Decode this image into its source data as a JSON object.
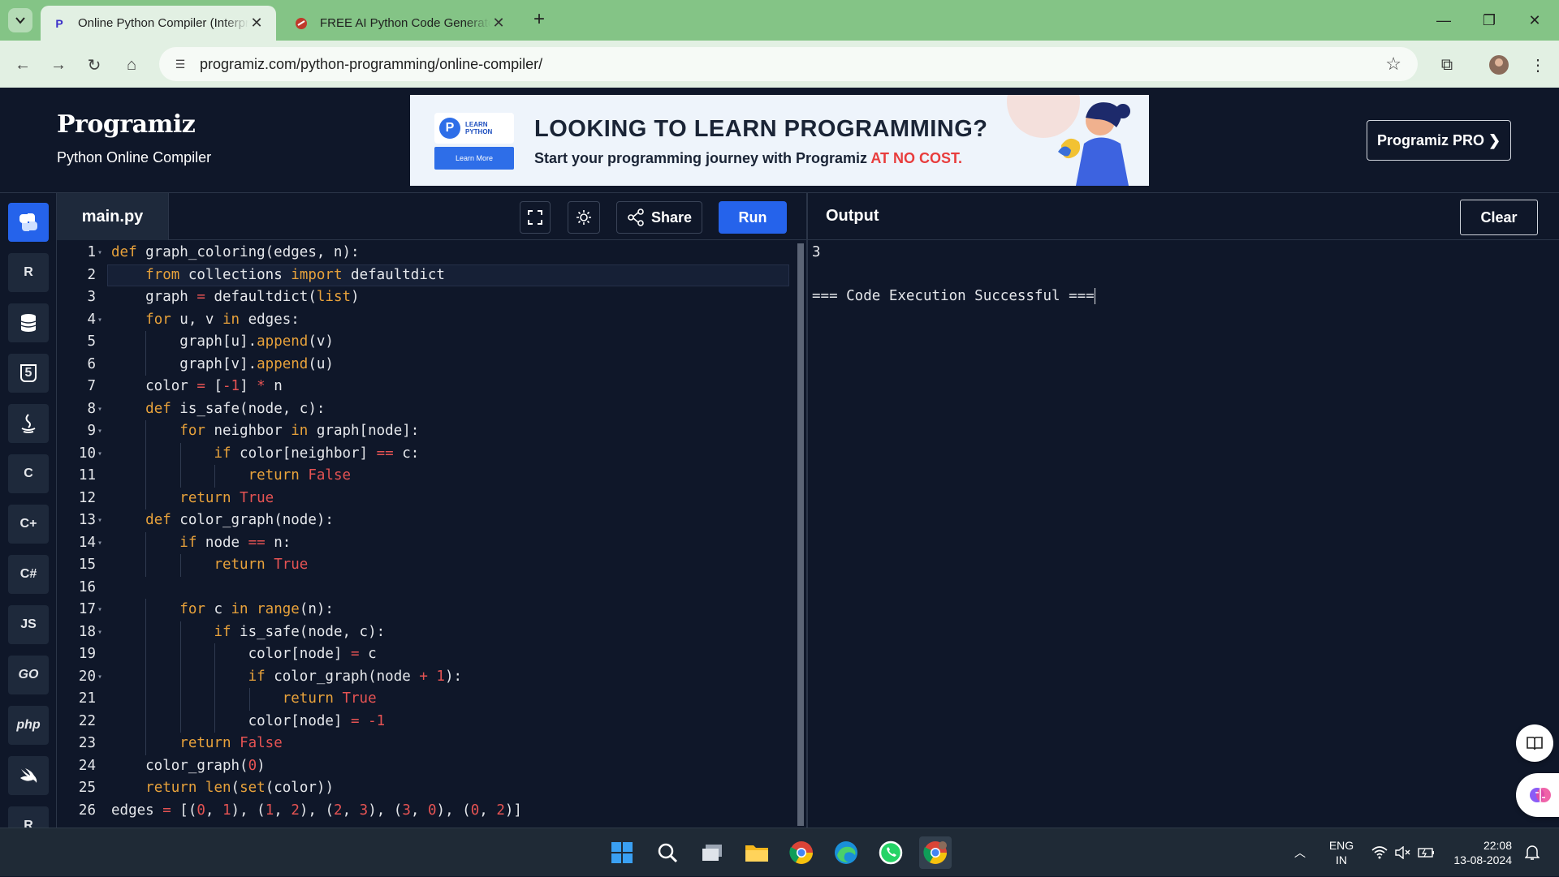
{
  "browser": {
    "tabs": [
      {
        "title": "Online Python Compiler (Interpreter)",
        "active": true
      },
      {
        "title": "FREE AI Python Code Generator",
        "active": false
      }
    ],
    "url": "programiz.com/python-programming/online-compiler/"
  },
  "header": {
    "logo_text": "Programiz",
    "subtitle": "Python Online Compiler",
    "pro_button": "Programiz PRO ❯"
  },
  "ad_banner": {
    "badge_line1": "LEARN",
    "badge_line2": "PYTHON",
    "learn_more": "Learn More",
    "headline": "LOOKING TO LEARN PROGRAMMING?",
    "sub_prefix": "Start your programming journey with Programiz ",
    "sub_highlight": "AT NO COST."
  },
  "sidebar": {
    "languages": [
      {
        "name": "python-icon",
        "label": "",
        "active": true
      },
      {
        "name": "r-icon",
        "label": "R"
      },
      {
        "name": "sql-icon",
        "label": ""
      },
      {
        "name": "html-icon",
        "label": "5"
      },
      {
        "name": "java-icon",
        "label": ""
      },
      {
        "name": "c-icon",
        "label": "C"
      },
      {
        "name": "cpp-icon",
        "label": "C+"
      },
      {
        "name": "csharp-icon",
        "label": "C#"
      },
      {
        "name": "js-icon",
        "label": "JS"
      },
      {
        "name": "go-icon",
        "label": "GO"
      },
      {
        "name": "php-icon",
        "label": "php"
      },
      {
        "name": "swift-icon",
        "label": ""
      },
      {
        "name": "rust-icon",
        "label": "R"
      }
    ]
  },
  "editor": {
    "file_name": "main.py",
    "share_label": "Share",
    "run_label": "Run",
    "lines": [
      "def graph_coloring(edges, n):",
      "    from collections import defaultdict",
      "    graph = defaultdict(list)",
      "    for u, v in edges:",
      "        graph[u].append(v)",
      "        graph[v].append(u)",
      "    color = [-1] * n",
      "    def is_safe(node, c):",
      "        for neighbor in graph[node]:",
      "            if color[neighbor] == c:",
      "                return False",
      "        return True",
      "    def color_graph(node):",
      "        if node == n:",
      "            return True",
      "",
      "        for c in range(n):",
      "            if is_safe(node, c):",
      "                color[node] = c",
      "                if color_graph(node + 1):",
      "                    return True",
      "                color[node] = -1",
      "        return False",
      "    color_graph(0)",
      "    return len(set(color))",
      "edges = [(0, 1), (1, 2), (2, 3), (3, 0), (0, 2)]"
    ],
    "fold_lines": [
      1,
      4,
      8,
      9,
      10,
      13,
      14,
      17,
      18,
      20
    ],
    "highlight_line": 2
  },
  "output": {
    "title": "Output",
    "clear_label": "Clear",
    "lines": [
      "3",
      "",
      "=== Code Execution Successful ==="
    ]
  },
  "taskbar": {
    "lang_top": "ENG",
    "lang_bottom": "IN",
    "time": "22:08",
    "date": "13-08-2024"
  }
}
